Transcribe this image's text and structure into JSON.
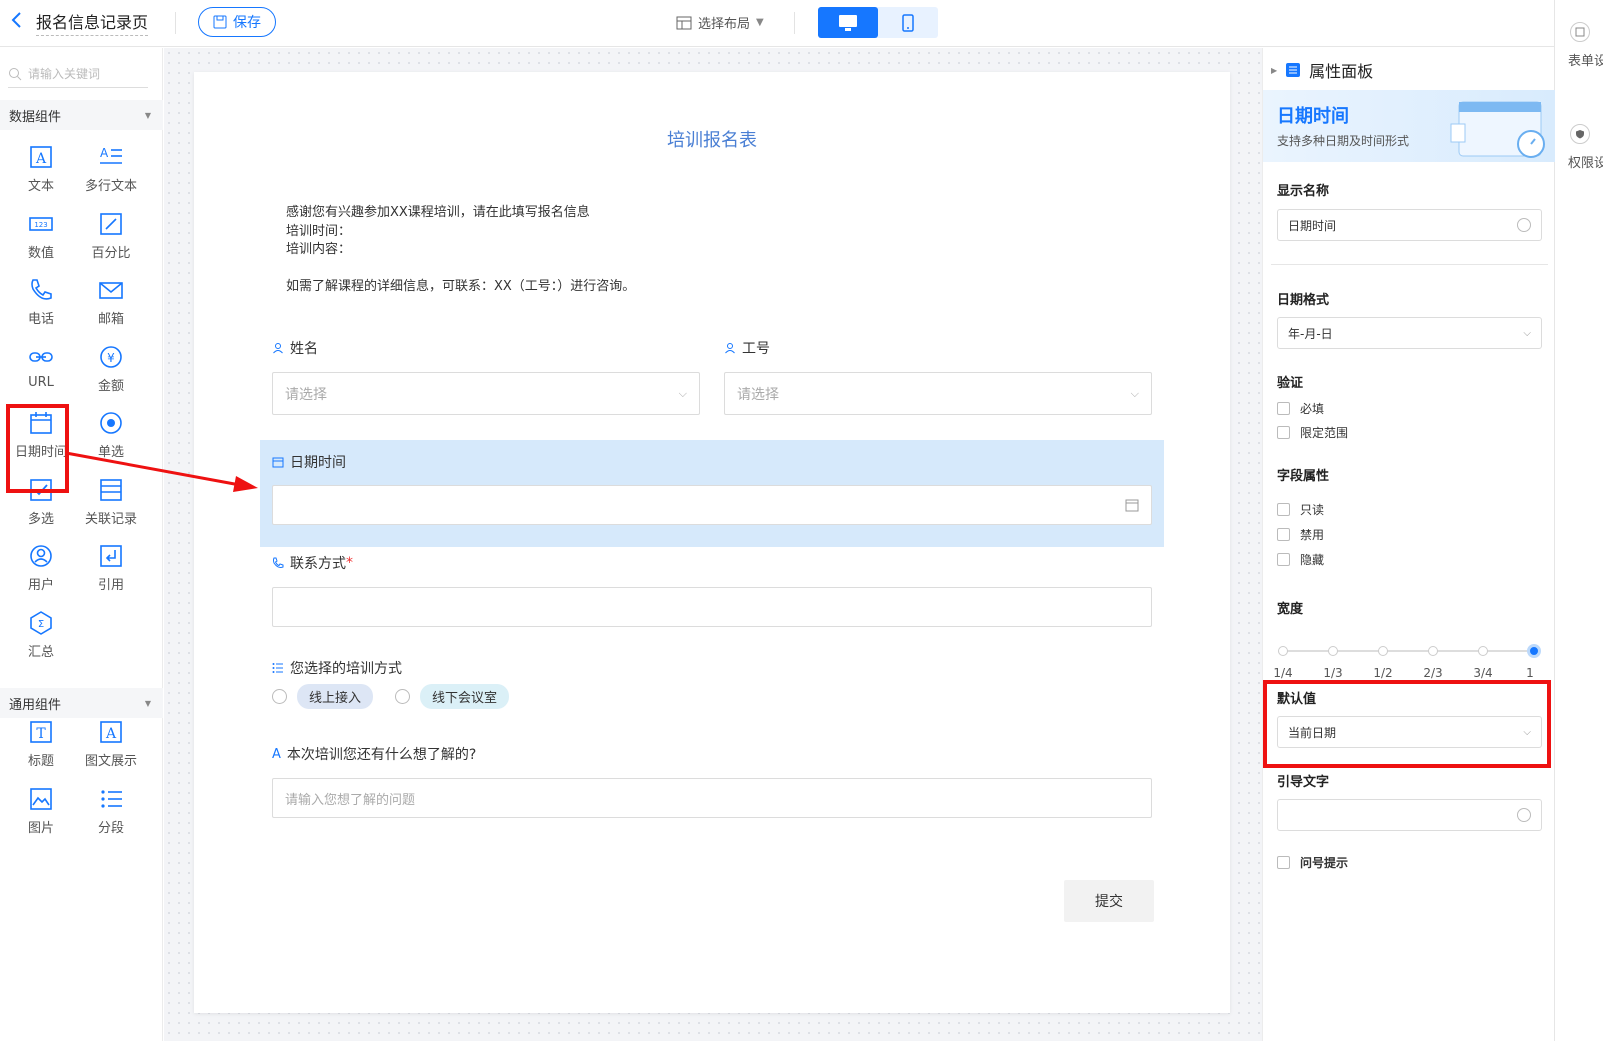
{
  "header": {
    "page_title": "报名信息记录页",
    "save_label": "保存",
    "layout_label": "选择布局"
  },
  "rail": {
    "form_settings": "表单设",
    "permission_settings": "权限设"
  },
  "left": {
    "search_placeholder": "请输入关键词",
    "data_group": "数据组件",
    "data_items": [
      "文本",
      "多行文本",
      "数值",
      "百分比",
      "电话",
      "邮箱",
      "URL",
      "金额",
      "日期时间",
      "单选",
      "多选",
      "关联记录",
      "用户",
      "引用",
      "汇总"
    ],
    "common_group": "通用组件",
    "common_items": [
      "标题",
      "图文展示",
      "图片",
      "分段"
    ]
  },
  "form": {
    "title": "培训报名表",
    "description": "感谢您有兴趣参加XX课程培训，请在此填写报名信息\n培训时间：\n培训内容：\n\n如需了解课程的详细信息，可联系：XX（工号：）进行咨询。",
    "name_label": "姓名",
    "id_label": "工号",
    "select_placeholder": "请选择",
    "datetime_label": "日期时间",
    "contact_label": "联系方式",
    "required_mark": "*",
    "training_label": "您选择的培训方式",
    "options": [
      "线上接入",
      "线下会议室"
    ],
    "question_label": "本次培训您还有什么想了解的?",
    "question_placeholder": "请输入您想了解的问题",
    "submit_label": "提交"
  },
  "props": {
    "panel_title": "属性面板",
    "banner_title": "日期时间",
    "banner_sub": "支持多种日期及时间形式",
    "display_name_label": "显示名称",
    "display_name_value": "日期时间",
    "format_label": "日期格式",
    "format_value": "年-月-日",
    "validation_label": "验证",
    "validation_items": [
      "必填",
      "限定范围"
    ],
    "field_attr_label": "字段属性",
    "field_attr_items": [
      "只读",
      "禁用",
      "隐藏"
    ],
    "width_label": "宽度",
    "width_ticks": [
      "1/4",
      "1/3",
      "1/2",
      "2/3",
      "3/4",
      "1"
    ],
    "width_selected": "1",
    "default_label": "默认值",
    "default_value": "当前日期",
    "guide_label": "引导文字",
    "tooltip_label": "问号提示"
  },
  "colors": {
    "accent": "#1677ff",
    "highlight": "#ee1111",
    "selected_bg": "#d6e9fb"
  }
}
